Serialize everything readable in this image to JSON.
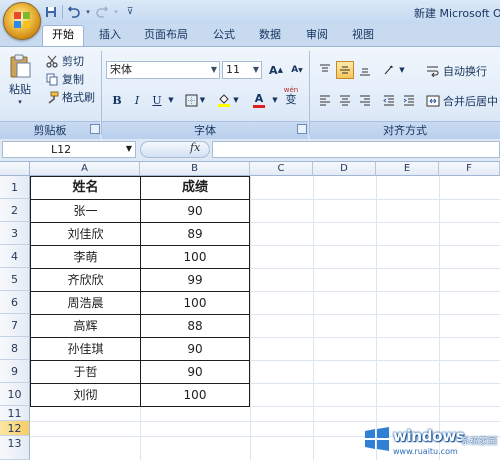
{
  "window": {
    "title": "新建 Microsoft O"
  },
  "tabs": [
    {
      "label": "开始",
      "active": true
    },
    {
      "label": "插入"
    },
    {
      "label": "页面布局"
    },
    {
      "label": "公式"
    },
    {
      "label": "数据"
    },
    {
      "label": "审阅"
    },
    {
      "label": "视图"
    }
  ],
  "clipboard": {
    "paste": "粘贴",
    "cut": "剪切",
    "copy": "复制",
    "format_painter": "格式刷",
    "group_label": "剪贴板"
  },
  "font": {
    "name": "宋体",
    "size": "11",
    "bold": "B",
    "italic": "I",
    "underline": "U",
    "color_letter": "A",
    "grow": "A",
    "shrink": "A",
    "phonetic_top": "wén",
    "phonetic_char": "变",
    "group_label": "字体"
  },
  "alignment": {
    "wrap_text": "自动换行",
    "merge_center": "合并后居中",
    "group_label": "对齐方式"
  },
  "formula_bar": {
    "name_box": "L12",
    "fx": "fx",
    "value": ""
  },
  "columns": [
    "A",
    "B",
    "C",
    "D",
    "E",
    "F"
  ],
  "rows": [
    "1",
    "2",
    "3",
    "4",
    "5",
    "6",
    "7",
    "8",
    "9",
    "10",
    "11",
    "12",
    "13"
  ],
  "table": {
    "headers": [
      "姓名",
      "成绩"
    ],
    "rows": [
      [
        "张一",
        "90"
      ],
      [
        "刘佳欣",
        "89"
      ],
      [
        "李萌",
        "100"
      ],
      [
        "齐欣欣",
        "99"
      ],
      [
        "周浩晨",
        "100"
      ],
      [
        "高辉",
        "88"
      ],
      [
        "孙佳琪",
        "90"
      ],
      [
        "于哲",
        "90"
      ],
      [
        "刘彻",
        "100"
      ]
    ]
  },
  "watermark": {
    "brand": "windows",
    "sub": "系统家园",
    "url": "www.ruaitu.com"
  },
  "colors": {
    "accent": "#f2c14a",
    "ribbon": "#dbe8f7",
    "watermark_blue": "#1d5fa8"
  }
}
